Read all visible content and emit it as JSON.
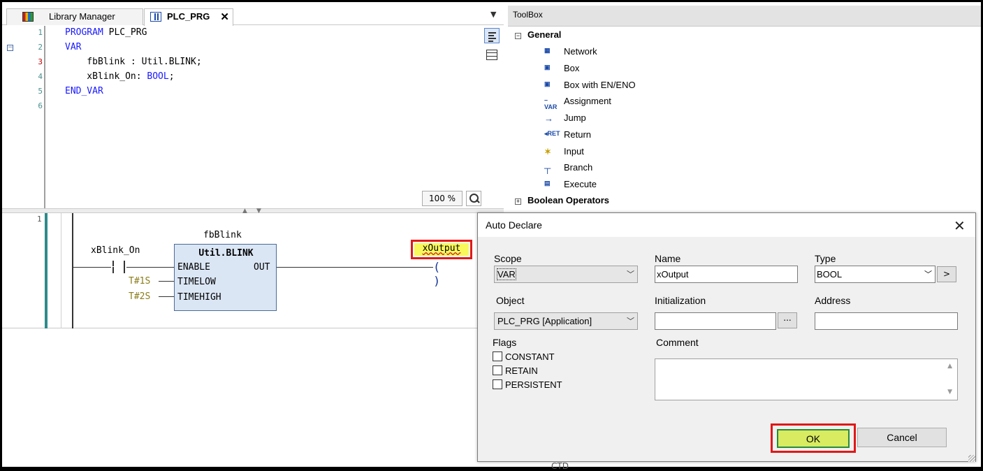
{
  "tabs": [
    {
      "label": "Library Manager",
      "active": false
    },
    {
      "label": "PLC_PRG",
      "active": true
    }
  ],
  "tab_close_glyph": "✕",
  "tabs_dropdown_glyph": "▼",
  "decl_editor": {
    "line_numbers": [
      "1",
      "2",
      "3",
      "4",
      "5",
      "6"
    ],
    "code_lines": [
      {
        "keyword": "PROGRAM",
        "rest": " PLC_PRG"
      },
      {
        "keyword": "VAR",
        "rest": ""
      },
      {
        "keyword": "",
        "rest": "    fbBlink : Util.BLINK;"
      },
      {
        "keyword": "",
        "rest": "    xBlink_On: ",
        "type_kw": "BOOL",
        "tail": ";"
      },
      {
        "keyword": "END_VAR",
        "rest": ""
      }
    ],
    "zoom": "100 %"
  },
  "network": {
    "number": "1",
    "input_var": "xBlink_On",
    "instance_name": "fbBlink",
    "fb_type": "Util.BLINK",
    "pins_in": [
      "ENABLE",
      "TIMELOW",
      "TIMEHIGH"
    ],
    "pin_out": "OUT",
    "timelow_value": "T#1S",
    "timehigh_value": "T#2S",
    "output_var": "xOutput",
    "coil_glyph": "( )"
  },
  "toolbox": {
    "title": "ToolBox",
    "category_general": "General",
    "category_boolean": "Boolean Operators",
    "items": [
      {
        "label": "Network",
        "icon": "network-icon"
      },
      {
        "label": "Box",
        "icon": "box-icon"
      },
      {
        "label": "Box with EN/ENO",
        "icon": "box-en-eno-icon"
      },
      {
        "label": "Assignment",
        "icon": "assignment-icon"
      },
      {
        "label": "Jump",
        "icon": "jump-icon"
      },
      {
        "label": "Return",
        "icon": "return-icon"
      },
      {
        "label": "Input",
        "icon": "input-icon"
      },
      {
        "label": "Branch",
        "icon": "branch-icon"
      },
      {
        "label": "Execute",
        "icon": "execute-icon"
      }
    ],
    "peek_item": "CTD"
  },
  "dialog": {
    "title": "Auto Declare",
    "scope_label": "Scope",
    "scope_value": "VAR",
    "name_label": "Name",
    "name_value": "xOutput",
    "type_label": "Type",
    "type_value": "BOOL",
    "type_more": ">",
    "object_label": "Object",
    "object_value": "PLC_PRG [Application]",
    "init_label": "Initialization",
    "init_value": "",
    "init_more": "...",
    "address_label": "Address",
    "address_value": "",
    "flags_label": "Flags",
    "flags": [
      "CONSTANT",
      "RETAIN",
      "PERSISTENT"
    ],
    "comment_label": "Comment",
    "comment_value": "",
    "ok": "OK",
    "cancel": "Cancel"
  },
  "colors": {
    "keyword": "#1a1aff",
    "time_literal": "#8b7d1a",
    "fb_fill": "#dbe6f5",
    "highlight_border": "#e01818",
    "ok_fill": "#d8eb61"
  }
}
